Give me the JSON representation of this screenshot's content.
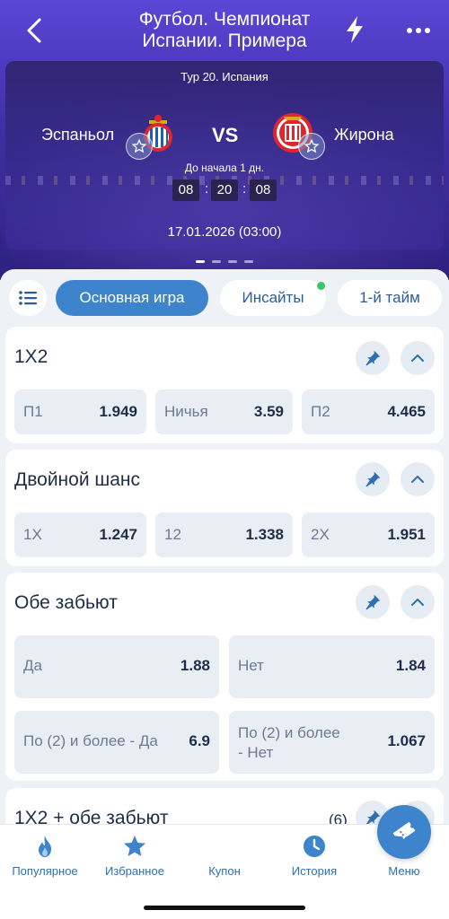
{
  "header": {
    "title_line1": "Футбол. Чемпионат",
    "title_line2": "Испании. Примера"
  },
  "match": {
    "tour": "Тур 20. Испания",
    "home_team": "Эспаньол",
    "away_team": "Жирона",
    "vs": "VS",
    "countdown_label": "До начала 1 дн.",
    "countdown": {
      "hours": "08",
      "minutes": "20",
      "seconds": "08",
      "separator": ":"
    },
    "date": "17.01.2026 (03:00)",
    "pager": {
      "pages": 4,
      "active": 0
    }
  },
  "tabs": [
    {
      "label": "Основная игра",
      "active": true
    },
    {
      "label": "Инсайты",
      "has_new": true
    },
    {
      "label": "1-й тайм"
    }
  ],
  "markets": [
    {
      "title": "1X2",
      "outcomes": [
        {
          "label": "П1",
          "odds": "1.949"
        },
        {
          "label": "Ничья",
          "odds": "3.59"
        },
        {
          "label": "П2",
          "odds": "4.465"
        }
      ]
    },
    {
      "title": "Двойной шанс",
      "outcomes": [
        {
          "label": "1X",
          "odds": "1.247"
        },
        {
          "label": "12",
          "odds": "1.338"
        },
        {
          "label": "2X",
          "odds": "1.951"
        }
      ]
    },
    {
      "title": "Обе забьют",
      "outcomes": [
        {
          "label": "Да",
          "odds": "1.88"
        },
        {
          "label": "Нет",
          "odds": "1.84"
        },
        {
          "label": "По (2) и более - Да",
          "odds": "6.9"
        },
        {
          "label_line1": "По (2) и более",
          "label_line2": "- Нет",
          "odds": "1.067"
        }
      ]
    },
    {
      "title": "1X2 + обе забьют",
      "count": "(6)"
    }
  ],
  "bottom_nav": [
    {
      "label": "Популярное",
      "icon": "flame-icon"
    },
    {
      "label": "Избранное",
      "icon": "star-icon"
    },
    {
      "label": "Купон",
      "icon": "ticket-icon"
    },
    {
      "label": "История",
      "icon": "clock-icon"
    },
    {
      "label": "Меню",
      "icon": "grid-icon"
    }
  ],
  "colors": {
    "accent": "#3d84cc",
    "header_bg": "#4a36b8",
    "nav_label": "#2f6fb0",
    "odds_tile": "#e9eef5",
    "notification": "#3ec36a"
  }
}
